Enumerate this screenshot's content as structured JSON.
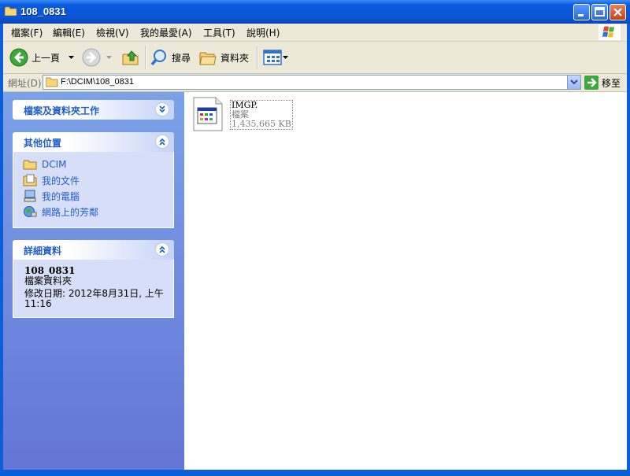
{
  "window": {
    "title": "108_0831"
  },
  "menu": {
    "items": [
      "檔案(F)",
      "編輯(E)",
      "檢視(V)",
      "我的最愛(A)",
      "工具(T)",
      "說明(H)"
    ]
  },
  "toolbar": {
    "back_label": "上一頁",
    "search_label": "搜尋",
    "folders_label": "資料夾"
  },
  "address": {
    "label": "網址(D)",
    "path": "F:\\DCIM\\108_0831",
    "go_label": "移至"
  },
  "tasks_panel": {
    "title": "檔案及資料夾工作"
  },
  "places_panel": {
    "title": "其他位置",
    "items": [
      {
        "label": "DCIM",
        "icon": "folder-icon"
      },
      {
        "label": "我的文件",
        "icon": "my-documents-icon"
      },
      {
        "label": "我的電腦",
        "icon": "my-computer-icon"
      },
      {
        "label": "網路上的芳鄰",
        "icon": "network-places-icon"
      }
    ]
  },
  "details_panel": {
    "title": "詳細資料",
    "name": "108_0831",
    "type": "檔案資料夾",
    "modified": "修改日期: 2012年8月31日, 上午",
    "modified_time": "11:16"
  },
  "file": {
    "name": "IMGP.",
    "type": "檔案",
    "size": "1,435,665 KB"
  },
  "colors": {
    "link": "#215dc6",
    "titlebar": "#0a56d6",
    "pane_top": "#7ba2e7",
    "pane_bottom": "#6375d6"
  }
}
